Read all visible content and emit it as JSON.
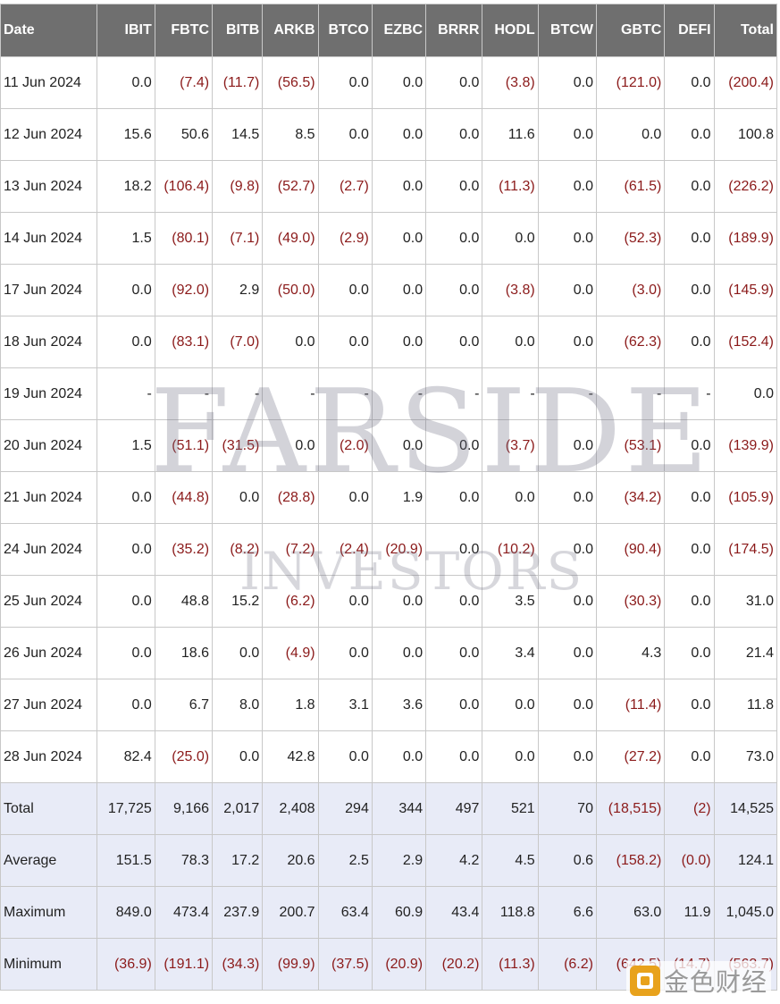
{
  "columns": [
    "Date",
    "IBIT",
    "FBTC",
    "BITB",
    "ARKB",
    "BTCO",
    "EZBC",
    "BRRR",
    "HODL",
    "BTCW",
    "GBTC",
    "DEFI",
    "Total"
  ],
  "rows": [
    [
      "11 Jun 2024",
      "0.0",
      "(7.4)",
      "(11.7)",
      "(56.5)",
      "0.0",
      "0.0",
      "0.0",
      "(3.8)",
      "0.0",
      "(121.0)",
      "0.0",
      "(200.4)"
    ],
    [
      "12 Jun 2024",
      "15.6",
      "50.6",
      "14.5",
      "8.5",
      "0.0",
      "0.0",
      "0.0",
      "11.6",
      "0.0",
      "0.0",
      "0.0",
      "100.8"
    ],
    [
      "13 Jun 2024",
      "18.2",
      "(106.4)",
      "(9.8)",
      "(52.7)",
      "(2.7)",
      "0.0",
      "0.0",
      "(11.3)",
      "0.0",
      "(61.5)",
      "0.0",
      "(226.2)"
    ],
    [
      "14 Jun 2024",
      "1.5",
      "(80.1)",
      "(7.1)",
      "(49.0)",
      "(2.9)",
      "0.0",
      "0.0",
      "0.0",
      "0.0",
      "(52.3)",
      "0.0",
      "(189.9)"
    ],
    [
      "17 Jun 2024",
      "0.0",
      "(92.0)",
      "2.9",
      "(50.0)",
      "0.0",
      "0.0",
      "0.0",
      "(3.8)",
      "0.0",
      "(3.0)",
      "0.0",
      "(145.9)"
    ],
    [
      "18 Jun 2024",
      "0.0",
      "(83.1)",
      "(7.0)",
      "0.0",
      "0.0",
      "0.0",
      "0.0",
      "0.0",
      "0.0",
      "(62.3)",
      "0.0",
      "(152.4)"
    ],
    [
      "19 Jun 2024",
      "-",
      "-",
      "-",
      "-",
      "-",
      "-",
      "-",
      "-",
      "-",
      "-",
      "-",
      "0.0"
    ],
    [
      "20 Jun 2024",
      "1.5",
      "(51.1)",
      "(31.5)",
      "0.0",
      "(2.0)",
      "0.0",
      "0.0",
      "(3.7)",
      "0.0",
      "(53.1)",
      "0.0",
      "(139.9)"
    ],
    [
      "21 Jun 2024",
      "0.0",
      "(44.8)",
      "0.0",
      "(28.8)",
      "0.0",
      "1.9",
      "0.0",
      "0.0",
      "0.0",
      "(34.2)",
      "0.0",
      "(105.9)"
    ],
    [
      "24 Jun 2024",
      "0.0",
      "(35.2)",
      "(8.2)",
      "(7.2)",
      "(2.4)",
      "(20.9)",
      "0.0",
      "(10.2)",
      "0.0",
      "(90.4)",
      "0.0",
      "(174.5)"
    ],
    [
      "25 Jun 2024",
      "0.0",
      "48.8",
      "15.2",
      "(6.2)",
      "0.0",
      "0.0",
      "0.0",
      "3.5",
      "0.0",
      "(30.3)",
      "0.0",
      "31.0"
    ],
    [
      "26 Jun 2024",
      "0.0",
      "18.6",
      "0.0",
      "(4.9)",
      "0.0",
      "0.0",
      "0.0",
      "3.4",
      "0.0",
      "4.3",
      "0.0",
      "21.4"
    ],
    [
      "27 Jun 2024",
      "0.0",
      "6.7",
      "8.0",
      "1.8",
      "3.1",
      "3.6",
      "0.0",
      "0.0",
      "0.0",
      "(11.4)",
      "0.0",
      "11.8"
    ],
    [
      "28 Jun 2024",
      "82.4",
      "(25.0)",
      "0.0",
      "42.8",
      "0.0",
      "0.0",
      "0.0",
      "0.0",
      "0.0",
      "(27.2)",
      "0.0",
      "73.0"
    ]
  ],
  "summary_rows": [
    [
      "Total",
      "17,725",
      "9,166",
      "2,017",
      "2,408",
      "294",
      "344",
      "497",
      "521",
      "70",
      "(18,515)",
      "(2)",
      "14,525"
    ],
    [
      "Average",
      "151.5",
      "78.3",
      "17.2",
      "20.6",
      "2.5",
      "2.9",
      "4.2",
      "4.5",
      "0.6",
      "(158.2)",
      "(0.0)",
      "124.1"
    ],
    [
      "Maximum",
      "849.0",
      "473.4",
      "237.9",
      "200.7",
      "63.4",
      "60.9",
      "43.4",
      "118.8",
      "6.6",
      "63.0",
      "11.9",
      "1,045.0"
    ],
    [
      "Minimum",
      "(36.9)",
      "(191.1)",
      "(34.3)",
      "(99.9)",
      "(37.5)",
      "(20.9)",
      "(20.2)",
      "(11.3)",
      "(6.2)",
      "(642.5)",
      "(14.7)",
      "(563.7)"
    ]
  ],
  "watermark": {
    "line1": "FARSIDE",
    "line2": "INVESTORS"
  },
  "corner_logo": {
    "text": "金色财经",
    "icon": "jinse-logo-icon"
  },
  "colors": {
    "header_bg": "#6f6f6f",
    "negative": "#8b1a1a",
    "summary_bg": "#e8ebf7"
  }
}
